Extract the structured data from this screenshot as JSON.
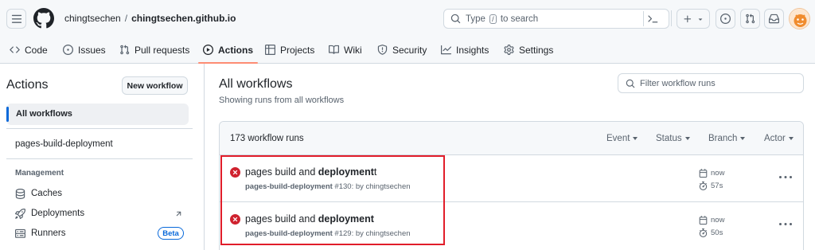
{
  "header": {
    "owner": "chingtsechen",
    "separator": "/",
    "repo": "chingtsechen.github.io",
    "search": {
      "prefix": "Type",
      "key": "/",
      "suffix": "to search"
    },
    "icons": [
      "menu-icon",
      "github-logo",
      "search-icon",
      "command-palette-icon",
      "plus-icon",
      "caret-down-icon",
      "issue-icon",
      "pull-request-icon",
      "inbox-icon",
      "avatar"
    ]
  },
  "nav": {
    "tabs": [
      {
        "label": "Code",
        "icon": "code-icon"
      },
      {
        "label": "Issues",
        "icon": "issue-icon"
      },
      {
        "label": "Pull requests",
        "icon": "pull-request-icon"
      },
      {
        "label": "Actions",
        "icon": "play-icon",
        "active": true
      },
      {
        "label": "Projects",
        "icon": "table-icon"
      },
      {
        "label": "Wiki",
        "icon": "book-icon"
      },
      {
        "label": "Security",
        "icon": "shield-icon"
      },
      {
        "label": "Insights",
        "icon": "graph-icon"
      },
      {
        "label": "Settings",
        "icon": "gear-icon"
      }
    ]
  },
  "sidebar": {
    "title": "Actions",
    "new_workflow": "New workflow",
    "all_workflows": "All workflows",
    "workflows": [
      "pages-build-deployment"
    ],
    "management_label": "Management",
    "management": [
      {
        "label": "Caches",
        "icon": "database-icon"
      },
      {
        "label": "Deployments",
        "icon": "rocket-icon"
      },
      {
        "label": "Runners",
        "icon": "server-icon",
        "badge": "Beta"
      }
    ]
  },
  "main": {
    "title": "All workflows",
    "subtitle": "Showing runs from all workflows",
    "filter_placeholder": "Filter workflow runs",
    "runs_count": "173 workflow runs",
    "filters": [
      "Event",
      "Status",
      "Branch",
      "Actor"
    ],
    "runs": [
      {
        "title_pre": "pages build and ",
        "title_bold": "deployment",
        "title_post": "t",
        "workflow": "pages-build-deployment",
        "meta": " #130: by chingtsechen",
        "when": "now",
        "duration": "57s",
        "status": "failed"
      },
      {
        "title_pre": "pages build and ",
        "title_bold": "deployment",
        "title_post": "",
        "workflow": "pages-build-deployment",
        "meta": " #129: by chingtsechen",
        "when": "now",
        "duration": "50s",
        "status": "failed"
      }
    ]
  },
  "colors": {
    "accent": "#0969da",
    "active_tab_underline": "#fd8c73",
    "failure": "#cf222e",
    "highlight": "#e11d2a"
  }
}
